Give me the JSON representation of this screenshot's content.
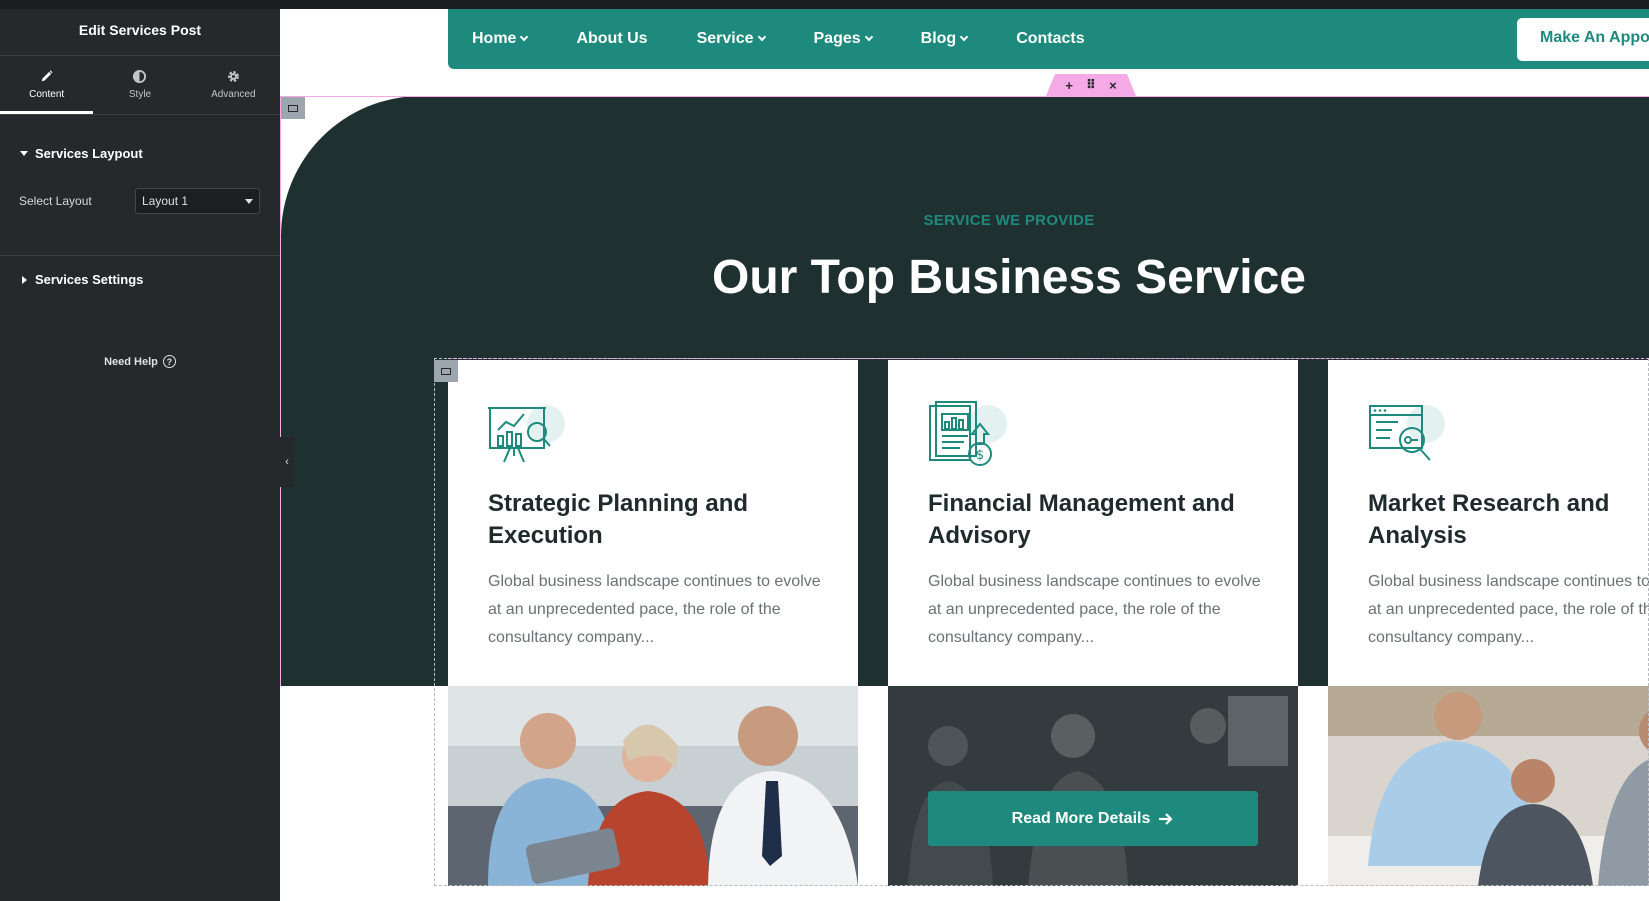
{
  "panel": {
    "title": "Edit Services Post",
    "tabs": [
      {
        "label": "Content",
        "icon": "pencil-icon"
      },
      {
        "label": "Style",
        "icon": "half-circle-icon"
      },
      {
        "label": "Advanced",
        "icon": "gear-icon"
      }
    ],
    "layout_section": "Services Laypout",
    "select_label": "Select Layout",
    "select_value": "Layout 1",
    "settings_section": "Services Settings",
    "need_help": "Need Help"
  },
  "nav": {
    "items": [
      {
        "label": "Home",
        "dropdown": true
      },
      {
        "label": "About Us",
        "dropdown": false
      },
      {
        "label": "Service",
        "dropdown": true
      },
      {
        "label": "Pages",
        "dropdown": true
      },
      {
        "label": "Blog",
        "dropdown": true
      },
      {
        "label": "Contacts",
        "dropdown": false
      }
    ],
    "cta": "Make An Appo"
  },
  "handle": {
    "add": "+",
    "move": "⠿",
    "close": "×"
  },
  "hero": {
    "eyebrow": "SERVICE WE PROVIDE",
    "title": "Our Top Business Service"
  },
  "cards": [
    {
      "title": "Strategic Planning and Execution",
      "desc": "Global business landscape continues to evolve at an unprecedented pace, the role of the consultancy company...",
      "icon": "presentation-chart-icon"
    },
    {
      "title": "Financial Management and Advisory",
      "desc": "Global business landscape continues to evolve at an unprecedented pace, the role of the consultancy company...",
      "icon": "financial-report-icon",
      "button": "Read More Details"
    },
    {
      "title": "Market Research and Analysis",
      "desc": "Global business landscape continues to evolve at an unprecedented pace, the role of the consultancy company...",
      "icon": "browser-search-icon"
    }
  ],
  "colors": {
    "accent": "#1e8a7e",
    "hero_bg": "#1f3030",
    "panel_bg": "#26292c",
    "handle": "#f5a9e7"
  }
}
